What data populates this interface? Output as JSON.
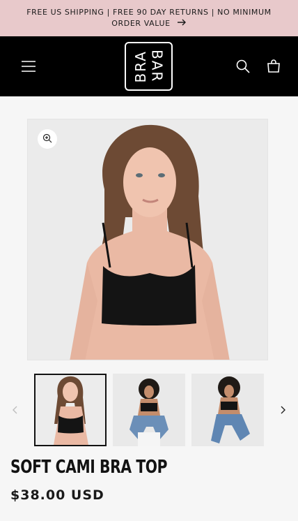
{
  "announcement": {
    "text": "FREE US SHIPPING | FREE 90 DAY RETURNS | NO MINIMUM ORDER VALUE"
  },
  "header": {
    "logo_text_left": "BRA",
    "logo_text_right": "BAR",
    "icons": [
      "hamburger-menu-icon",
      "search-icon",
      "cart-icon"
    ]
  },
  "product": {
    "title": "SOFT CAMI BRA TOP",
    "price": "$38.00 USD"
  },
  "gallery": {
    "thumbnail_count_visible": 3,
    "selected_thumbnail": 1
  },
  "colors": {
    "announcement_bg": "#e8c9cb",
    "header_bg": "#000000",
    "page_bg": "#f6f6f6"
  }
}
